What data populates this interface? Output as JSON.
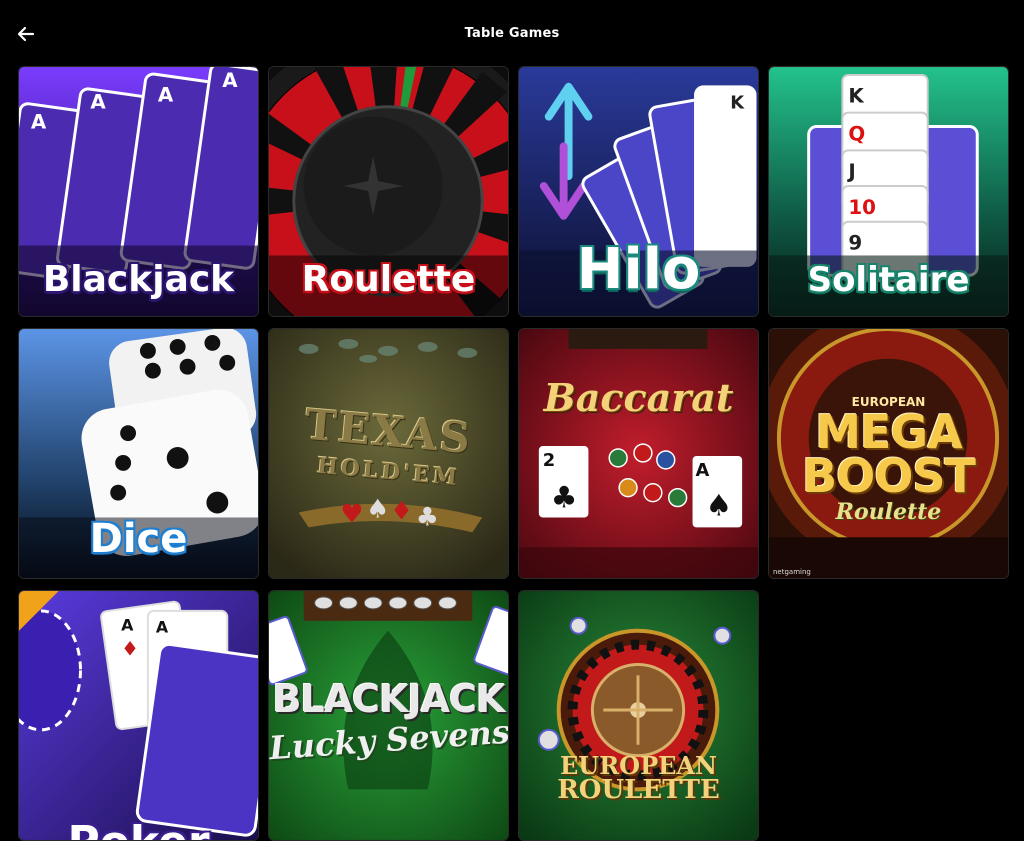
{
  "header": {
    "back_icon": "arrow-left-icon",
    "title": "Table Games"
  },
  "games": {
    "blackjack": {
      "title": "Blackjack"
    },
    "roulette": {
      "title": "Roulette"
    },
    "hilo": {
      "title": "Hilo"
    },
    "solitaire": {
      "title": "Solitaire"
    },
    "dice": {
      "title": "Dice"
    },
    "texas_holdem": {
      "line1": "TEXAS",
      "line2": "HOLD'EM"
    },
    "baccarat": {
      "title": "Baccarat"
    },
    "mega_boost": {
      "line0": "EUROPEAN",
      "line1": "MEGA",
      "line2": "BOOST",
      "line3": "Roulette",
      "provider": "netgaming"
    },
    "poker": {
      "title": "Poker"
    },
    "blackjack_lucky_sevens": {
      "line1": "BLACKJACK",
      "line2": "Lucky Sevens"
    },
    "european_roulette": {
      "line1": "EUROPEAN",
      "line2": "ROULETTE"
    }
  },
  "colors": {
    "background": "#000000",
    "blackjack_bg": "#5b2bd0",
    "roulette_red": "#c8101a",
    "hilo_bg": "#1f2a6b",
    "solitaire_bg": "#1fae7e",
    "dice_bg": "#4a86d8",
    "baccarat_bg": "#9d1420",
    "felt_green": "#1f7a2a"
  }
}
